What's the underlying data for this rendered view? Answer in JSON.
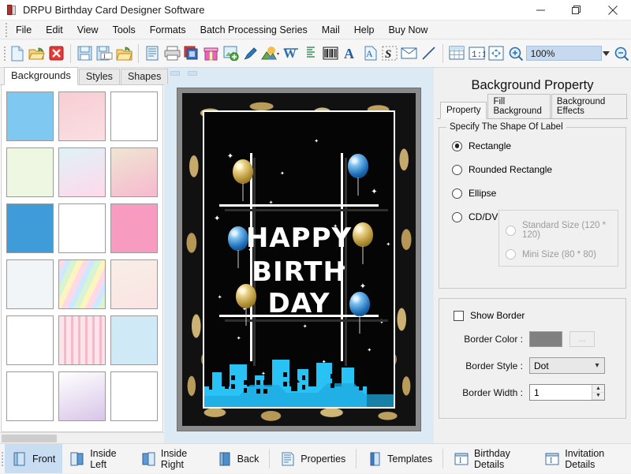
{
  "window": {
    "title": "DRPU Birthday Card Designer Software",
    "app_icon": "book-icon",
    "minimize": "minimize-icon",
    "maximize": "restore-icon",
    "close": "close-icon"
  },
  "menubar": {
    "items": [
      "File",
      "Edit",
      "View",
      "Tools",
      "Formats",
      "Batch Processing Series",
      "Mail",
      "Help",
      "Buy Now"
    ]
  },
  "toolbar": {
    "groups": [
      [
        "new-document-icon",
        "open-folder-icon",
        "close-document-icon"
      ],
      [
        "save-icon",
        "save-as-icon",
        "export-icon"
      ],
      [
        "properties-icon",
        "print-icon",
        "copy-layers-icon",
        "gift-icon",
        "add-image-icon",
        "pen-icon",
        "picture-icon",
        "watermark-icon"
      ],
      [
        "align-text-icon",
        "barcode-icon",
        "text-icon",
        "text-document-icon",
        "signature-icon",
        "envelope-icon",
        "line-icon"
      ],
      [
        "grid-icon",
        "actual-size-icon",
        "fit-page-icon",
        "zoom-in-icon"
      ]
    ],
    "zoom_value": "100%",
    "zoom_dropdown_icon": "chevron-down-icon",
    "zoom_out_icon": "zoom-out-icon"
  },
  "left_panel": {
    "tabs": [
      {
        "label": "Backgrounds",
        "active": true
      },
      {
        "label": "Styles",
        "active": false
      },
      {
        "label": "Shapes",
        "active": false
      }
    ],
    "thumbnails": [
      {
        "name": "clouds-sky",
        "c1": "#7ec8f2",
        "c2": "#ffffff",
        "kind": "clouds"
      },
      {
        "name": "pink-texture",
        "c1": "#f7cdd3",
        "c2": "#fadfe3",
        "kind": "plain"
      },
      {
        "name": "butterflies-flowers",
        "c1": "#ffffff",
        "c2": "#f6dcee",
        "kind": "confetti"
      },
      {
        "name": "daisy-flowers",
        "c1": "#eef7e2",
        "c2": "#fff6b0",
        "kind": "flowers"
      },
      {
        "name": "pastel-fairies",
        "c1": "#dff2f7",
        "c2": "#ffd9ea",
        "kind": "soft"
      },
      {
        "name": "beige-bird",
        "c1": "#efe5d2",
        "c2": "#f7b9cf",
        "kind": "soft"
      },
      {
        "name": "blue-stars",
        "c1": "#3f9cd8",
        "c2": "#ffffff",
        "kind": "stars"
      },
      {
        "name": "white-balloons",
        "c1": "#ffffff",
        "c2": "#ffe9a8",
        "kind": "balloons"
      },
      {
        "name": "pink-fairy-roses",
        "c1": "#f89bc0",
        "c2": "#ffd36b",
        "kind": "confetti"
      },
      {
        "name": "white-clouds",
        "c1": "#f2f5f8",
        "c2": "#ffffff",
        "kind": "clouds"
      },
      {
        "name": "rainbow-stripes",
        "c1": "#b9e2f5",
        "c2": "#ffd2e8",
        "kind": "rainbow"
      },
      {
        "name": "cream-floral",
        "c1": "#f7efe6",
        "c2": "#fbe3e3",
        "kind": "soft"
      },
      {
        "name": "happy-birthday-balloons",
        "c1": "#ffffff",
        "c2": "#bfe6c8",
        "kind": "balloons"
      },
      {
        "name": "pink-stripe-hearts",
        "c1": "#fce4ea",
        "c2": "#f8b8c8",
        "kind": "stripes"
      },
      {
        "name": "sky-balloons",
        "c1": "#cfe9f7",
        "c2": "#58a6dd",
        "kind": "balloons"
      },
      {
        "name": "pastel-hearts-outline",
        "c1": "#ffffff",
        "c2": "#9fe3ef",
        "kind": "hearts"
      },
      {
        "name": "blossom-branches",
        "c1": "#ffffff",
        "c2": "#d8c5e8",
        "kind": "soft"
      },
      {
        "name": "red-hearts",
        "c1": "#ffffff",
        "c2": "#e02b2b",
        "kind": "hearts"
      }
    ],
    "scrollbar": "horizontal-scrollbar"
  },
  "canvas": {
    "card": {
      "lines": [
        "HAPPY",
        "BIRTH",
        "DAY"
      ],
      "background_style": "gold-floral-black",
      "accent_gold": "#d4b46c",
      "accent_blue": "#1d6fb8",
      "skyline_color": "#29c2f5"
    }
  },
  "right_panel": {
    "title": "Background Property",
    "tabs": [
      {
        "label": "Property",
        "active": true
      },
      {
        "label": "Fill Background",
        "active": false
      },
      {
        "label": "Background Effects",
        "active": false
      }
    ],
    "shape_group": {
      "legend": "Specify The Shape Of Label",
      "options": [
        {
          "label": "Rectangle",
          "checked": true,
          "disabled": false
        },
        {
          "label": "Rounded Rectangle",
          "checked": false,
          "disabled": false
        },
        {
          "label": "Ellipse",
          "checked": false,
          "disabled": false
        },
        {
          "label": "CD/DVD",
          "checked": false,
          "disabled": false
        }
      ],
      "cd_sizes": [
        {
          "label": "Standard Size (120 * 120)",
          "checked": false,
          "disabled": true
        },
        {
          "label": "Mini Size (80 * 80)",
          "checked": false,
          "disabled": true
        }
      ]
    },
    "border_group": {
      "show_border_label": "Show Border",
      "show_border_checked": false,
      "border_color_label": "Border Color :",
      "border_color_value": "#808080",
      "browse_label": "...",
      "border_style_label": "Border Style :",
      "border_style_value": "Dot",
      "border_width_label": "Border Width :",
      "border_width_value": "1"
    }
  },
  "bottom_bar": {
    "items": [
      {
        "label": "Front",
        "icon": "card-front-icon",
        "active": true
      },
      {
        "label": "Inside Left",
        "icon": "card-inside-left-icon",
        "active": false
      },
      {
        "label": "Inside Right",
        "icon": "card-inside-right-icon",
        "active": false
      },
      {
        "label": "Back",
        "icon": "card-back-icon",
        "active": false
      },
      {
        "label": "Properties",
        "icon": "properties-icon",
        "active": false
      },
      {
        "label": "Templates",
        "icon": "templates-icon",
        "active": false
      },
      {
        "label": "Birthday Details",
        "icon": "birthday-details-icon",
        "active": false
      },
      {
        "label": "Invitation Details",
        "icon": "invitation-details-icon",
        "active": false
      }
    ]
  }
}
